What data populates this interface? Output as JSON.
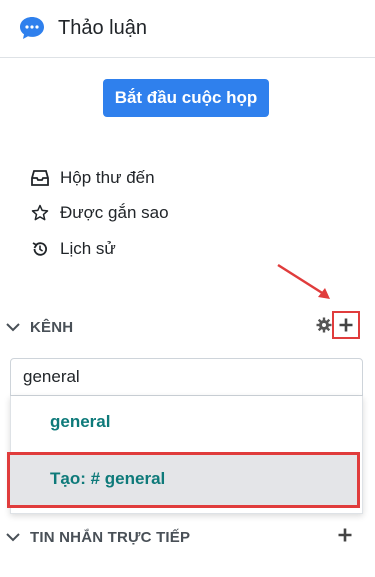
{
  "header": {
    "title": "Thảo luận",
    "icon": "chat-bubble-icon"
  },
  "start_meeting_label": "Bắt đầu cuộc họp",
  "nav": [
    {
      "label": "Hộp thư đến",
      "icon": "inbox-icon"
    },
    {
      "label": "Được gắn sao",
      "icon": "star-icon"
    },
    {
      "label": "Lịch sử",
      "icon": "history-icon"
    }
  ],
  "channels": {
    "label": "KÊNH",
    "search_value": "general",
    "options": [
      "general",
      "Tạo: # general"
    ]
  },
  "direct_messages": {
    "label": "TIN NHẮN TRỰC TIẾP"
  },
  "colors": {
    "accent": "#2f80ed",
    "highlight": "#e03c3c",
    "channel_text": "#0e7a7a"
  }
}
